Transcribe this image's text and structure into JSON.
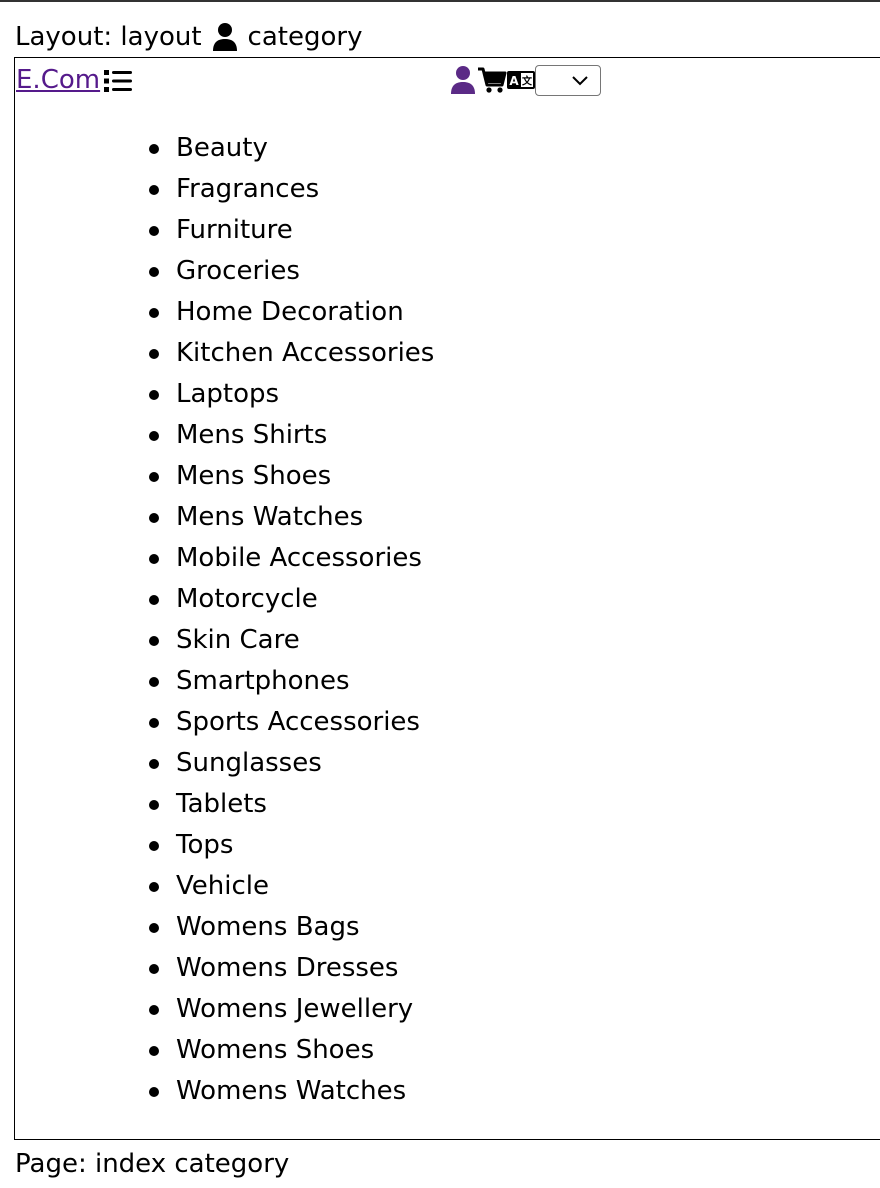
{
  "layout_line": {
    "prefix": "Layout: layout",
    "icon": "person-icon",
    "suffix": "category"
  },
  "navbar": {
    "brand": "E.Com",
    "menu_icon": "list-icon",
    "user_icon": "user-icon",
    "cart_icon": "cart-icon",
    "language_icon": "translate-icon",
    "language_select_value": "",
    "user_icon_color": "#5b2a86"
  },
  "categories": [
    "Beauty",
    "Fragrances",
    "Furniture",
    "Groceries",
    "Home Decoration",
    "Kitchen Accessories",
    "Laptops",
    "Mens Shirts",
    "Mens Shoes",
    "Mens Watches",
    "Mobile Accessories",
    "Motorcycle",
    "Skin Care",
    "Smartphones",
    "Sports Accessories",
    "Sunglasses",
    "Tablets",
    "Tops",
    "Vehicle",
    "Womens Bags",
    "Womens Dresses",
    "Womens Jewellery",
    "Womens Shoes",
    "Womens Watches"
  ],
  "page_line": "Page: index category",
  "colors": {
    "link": "#551a8b",
    "text": "#000000",
    "user_icon": "#5b2a86"
  }
}
